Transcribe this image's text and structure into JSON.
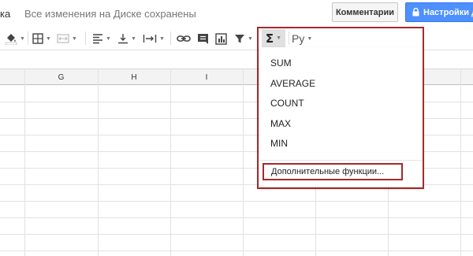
{
  "header": {
    "title_fragment": "ка",
    "save_status": "Все изменения на Диске сохранены",
    "comments_label": "Комментарии",
    "share_label": "Настройки д",
    "lock_icon": "lock-icon"
  },
  "toolbar": {
    "icons": [
      "fill-color-icon",
      "borders-icon",
      "merge-cells-icon",
      "align-left-icon",
      "valign-bottom-icon",
      "text-wrap-icon",
      "link-icon",
      "comment-icon",
      "chart-icon",
      "filter-icon",
      "sigma-icon"
    ],
    "sigma_label": "Σ",
    "lang_label": "Ру"
  },
  "grid": {
    "columns": [
      "G",
      "H",
      "I"
    ]
  },
  "function_menu": {
    "items": [
      "SUM",
      "AVERAGE",
      "COUNT",
      "MAX",
      "MIN"
    ],
    "more_label": "Дополнительные функции..."
  },
  "colors": {
    "highlight": "#a52a2a",
    "share_button": "#4d90fe",
    "active_button": "#e0e0e0"
  }
}
